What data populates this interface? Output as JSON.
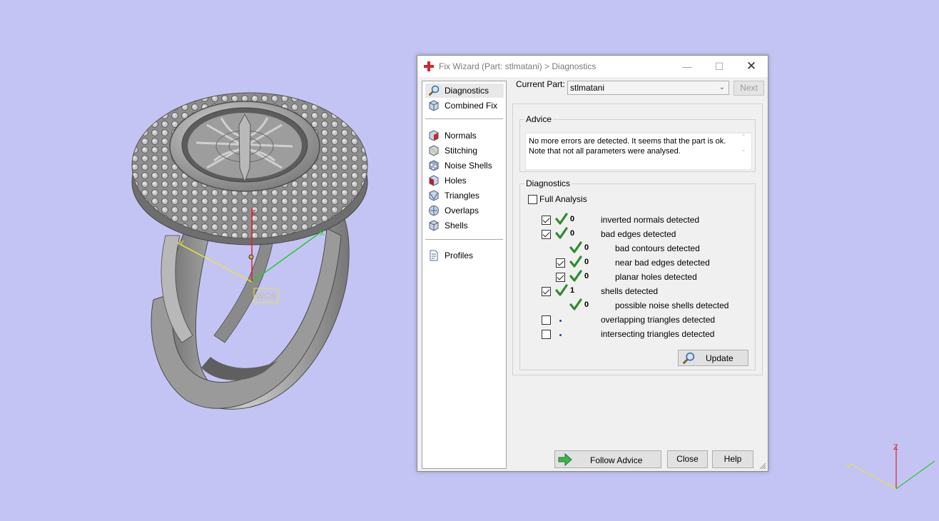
{
  "viewport": {
    "background": "#c4c4f4",
    "wcs_label": "WCS",
    "axes": {
      "x": "X",
      "y": "Y",
      "z": "Z"
    }
  },
  "dialog": {
    "title": "Fix Wizard (Part: stlmatani) > Diagnostics",
    "nav": {
      "top_items": [
        {
          "label": "Diagnostics",
          "icon": "magnifier-icon",
          "selected": true
        },
        {
          "label": "Combined Fix",
          "icon": "cube-icon"
        }
      ],
      "fix_items": [
        {
          "label": "Normals",
          "icon": "normals-cube-icon"
        },
        {
          "label": "Stitching",
          "icon": "stitching-cube-icon"
        },
        {
          "label": "Noise Shells",
          "icon": "noise-shells-icon"
        },
        {
          "label": "Holes",
          "icon": "holes-cube-icon"
        },
        {
          "label": "Triangles",
          "icon": "triangles-cube-icon"
        },
        {
          "label": "Overlaps",
          "icon": "overlaps-cube-icon"
        },
        {
          "label": "Shells",
          "icon": "shells-cube-icon"
        }
      ],
      "profiles": {
        "label": "Profiles",
        "icon": "document-icon"
      }
    },
    "current_part_label": "Current Part:",
    "current_part_value": "stlmatani",
    "next_label": "Next",
    "advice": {
      "title": "Advice",
      "text": "No more errors are detected. It seems that the part is ok.\nNote that not all parameters were analysed."
    },
    "diagnostics": {
      "title": "Diagnostics",
      "full_analysis_label": "Full Analysis",
      "full_analysis_checked": false,
      "rows": [
        {
          "checkbox": true,
          "checked": true,
          "status": "ok",
          "count": "0",
          "label": "inverted normals detected",
          "indent": 0
        },
        {
          "checkbox": true,
          "checked": true,
          "status": "ok",
          "count": "0",
          "label": "bad edges detected",
          "indent": 0
        },
        {
          "checkbox": false,
          "checked": false,
          "status": "ok",
          "count": "0",
          "label": "bad contours detected",
          "indent": 1
        },
        {
          "checkbox": true,
          "checked": true,
          "status": "ok",
          "count": "0",
          "label": "near bad edges detected",
          "indent": 1
        },
        {
          "checkbox": true,
          "checked": true,
          "status": "ok",
          "count": "0",
          "label": "planar holes detected",
          "indent": 1
        },
        {
          "checkbox": true,
          "checked": true,
          "status": "ok",
          "count": "1",
          "label": "shells detected",
          "indent": 0
        },
        {
          "checkbox": false,
          "checked": false,
          "status": "ok",
          "count": "0",
          "label": "possible noise shells detected",
          "indent": 1
        },
        {
          "checkbox": true,
          "checked": false,
          "status": "pending",
          "count": "",
          "label": "overlapping triangles detected",
          "indent": 0
        },
        {
          "checkbox": true,
          "checked": false,
          "status": "pending",
          "count": "",
          "label": "intersecting triangles detected",
          "indent": 0
        }
      ],
      "update_label": "Update"
    },
    "footer": {
      "follow_advice_label": "Follow Advice",
      "close_label": "Close",
      "help_label": "Help"
    }
  }
}
